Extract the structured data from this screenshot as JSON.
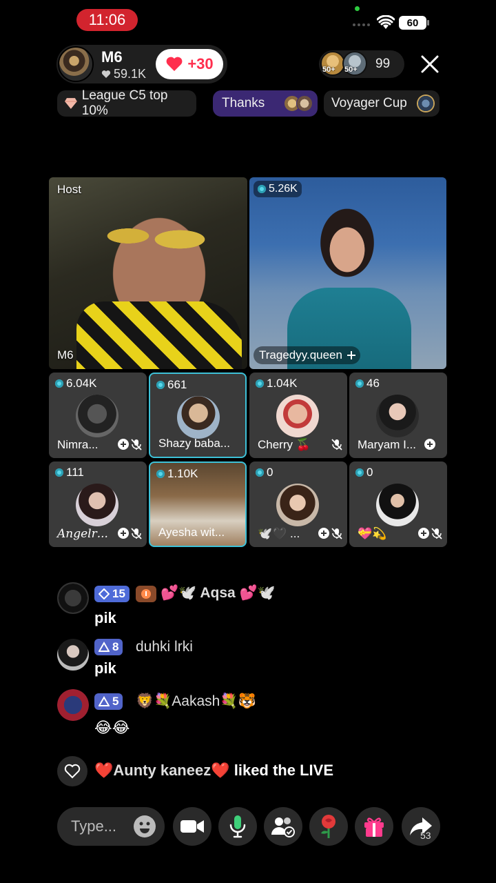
{
  "status": {
    "time": "11:06",
    "battery": "60"
  },
  "host": {
    "name": "M6",
    "likes": "59.1K",
    "like_gain": "+30"
  },
  "viewers": {
    "badge1": "50+",
    "badge2": "50+",
    "count": "99"
  },
  "chips": {
    "league": "League C5 top 10%",
    "thanks": "Thanks",
    "voyager": "Voyager Cup"
  },
  "main_tiles": {
    "host": {
      "tag": "Host",
      "name": "M6"
    },
    "guest": {
      "count": "5.26K",
      "name": "Tragedyy.queen"
    }
  },
  "grid": [
    {
      "count": "6.04K",
      "name": "Nimra..."
    },
    {
      "count": "661",
      "name": "Shazy baba..."
    },
    {
      "count": "1.04K",
      "name": "Cherry 🍒"
    },
    {
      "count": "46",
      "name": "Maryam I..."
    },
    {
      "count": "111",
      "name": "𝐴𝑛𝑔𝑒𝑙𝑟..."
    },
    {
      "count": "1.10K",
      "name": "Ayesha wit..."
    },
    {
      "count": "0",
      "name": "🕊️🖤 ..."
    },
    {
      "count": "0",
      "name": "💝💫"
    }
  ],
  "comments": [
    {
      "level": "15",
      "name": "💕🕊️ Aqsa 💕🕊️",
      "text": "pik"
    },
    {
      "level": "8",
      "name": "duhki lrki",
      "text": "pik"
    },
    {
      "level": "5",
      "name": "🦁💐Aakash💐🐯",
      "text": "😂😂"
    }
  ],
  "liked": {
    "name": "❤️Aunty kaneez❤️",
    "action": "liked the LIVE"
  },
  "bottom": {
    "placeholder": "Type...",
    "share_count": "53"
  },
  "colors": {
    "accent": "#3b2873",
    "live_red": "#d2242e",
    "highlight": "#3dc1d8"
  }
}
